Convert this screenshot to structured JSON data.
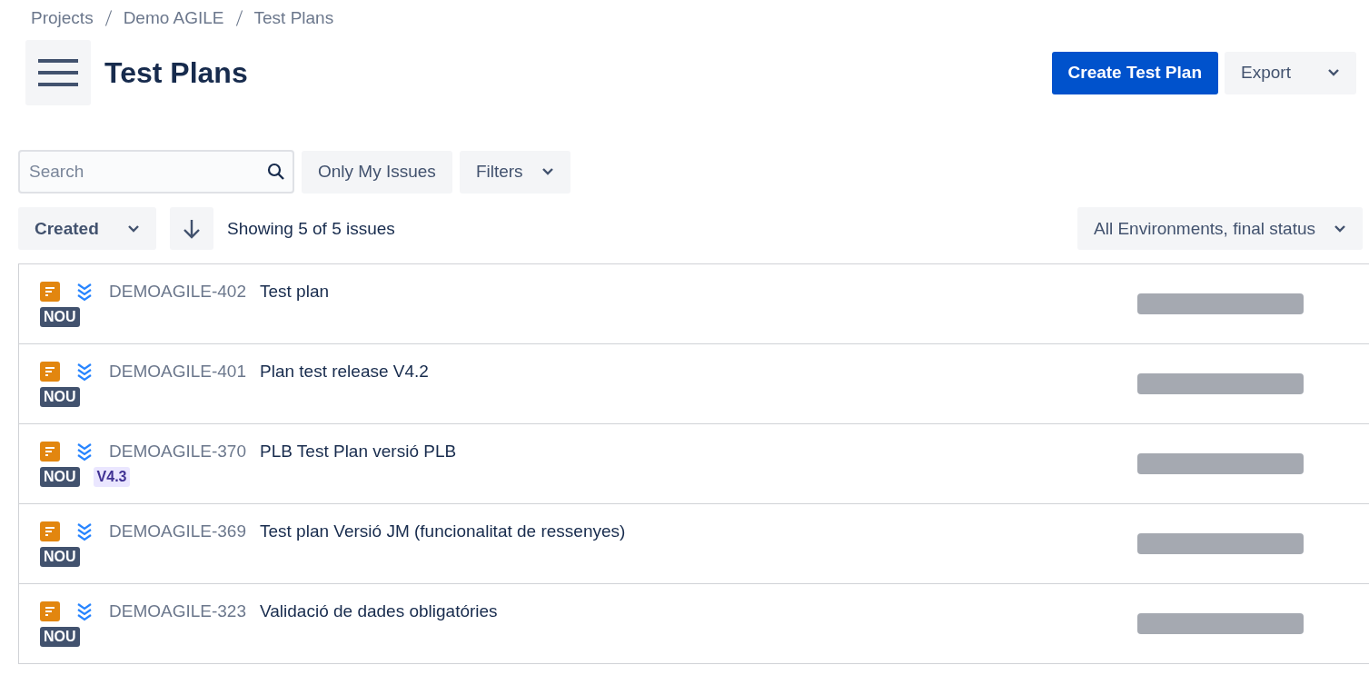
{
  "breadcrumbs": [
    "Projects",
    "Demo AGILE",
    "Test Plans"
  ],
  "title": "Test Plans",
  "actions": {
    "create": "Create Test Plan",
    "export": "Export"
  },
  "search": {
    "placeholder": "Search"
  },
  "filters": {
    "only_mine": "Only My Issues",
    "filters": "Filters"
  },
  "sort": {
    "field": "Created",
    "summary": "Showing 5 of 5 issues",
    "environment": "All Environments, final status"
  },
  "issues": [
    {
      "key": "DEMOAGILE-402",
      "summary": "Test plan",
      "tags": [
        {
          "kind": "status",
          "text": "NOU"
        }
      ]
    },
    {
      "key": "DEMOAGILE-401",
      "summary": "Plan test release V4.2",
      "tags": [
        {
          "kind": "status",
          "text": "NOU"
        }
      ]
    },
    {
      "key": "DEMOAGILE-370",
      "summary": "PLB Test Plan versió PLB",
      "tags": [
        {
          "kind": "status",
          "text": "NOU"
        },
        {
          "kind": "version",
          "text": "V4.3"
        }
      ]
    },
    {
      "key": "DEMOAGILE-369",
      "summary": "Test plan Versió JM (funcionalitat de ressenyes)",
      "tags": [
        {
          "kind": "status",
          "text": "NOU"
        }
      ]
    },
    {
      "key": "DEMOAGILE-323",
      "summary": "Validació de dades obligatóries",
      "tags": [
        {
          "kind": "status",
          "text": "NOU"
        }
      ]
    }
  ]
}
